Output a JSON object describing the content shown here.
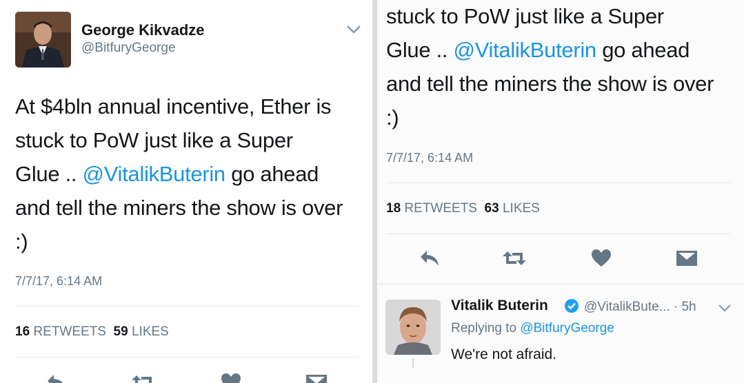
{
  "left_tweet": {
    "author_name": "George Kikvadze",
    "author_handle": "@BitfuryGeorge",
    "lines": [
      {
        "text": "At $4bln annual incentive, Ether is"
      },
      {
        "text": "stuck to PoW just like a Super"
      },
      {
        "pre": "Glue .. ",
        "mention": "@VitalikButerin",
        "post": " go ahead"
      },
      {
        "text": "and tell the miners the show is over"
      },
      {
        "text": ":)"
      }
    ],
    "date": "7/7/17, 6:14 AM",
    "retweets_count": "16",
    "retweets_label": "RETWEETS",
    "likes_count": "59",
    "likes_label": "LIKES"
  },
  "right_tweet": {
    "lines": [
      {
        "text": "stuck to PoW just like a Super"
      },
      {
        "pre": "Glue .. ",
        "mention": "@VitalikButerin",
        "post": " go ahead"
      },
      {
        "text": "and tell the miners the show is over"
      },
      {
        "text": ":)"
      }
    ],
    "date": "7/7/17, 6:14 AM",
    "retweets_count": "18",
    "retweets_label": "RETWEETS",
    "likes_count": "63",
    "likes_label": "LIKES"
  },
  "reply": {
    "author_name": "Vitalik Buterin",
    "author_handle": "@VitalikBute...",
    "time": "· 5h",
    "replying_prefix": "Replying to",
    "replying_to": "@BitfuryGeorge",
    "text": "We're not afraid."
  },
  "icons": [
    "reply-icon",
    "retweet-icon",
    "like-icon",
    "message-icon",
    "chevron-down-icon",
    "verified-badge-icon"
  ],
  "colors": {
    "mention": "#1b95e0",
    "text": "#14171a",
    "secondary": "#657786",
    "divider": "#e1e8ed",
    "verified": "#1da1f2"
  }
}
